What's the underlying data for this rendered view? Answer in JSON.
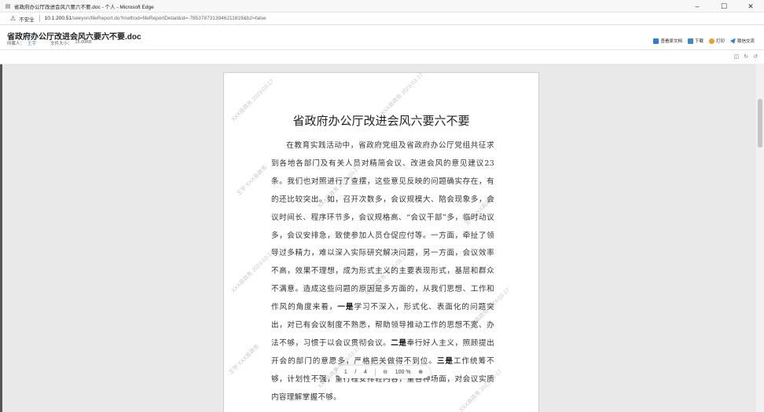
{
  "window": {
    "title": "省政府办公厅改进会风六要六不要.doc - 个人 - Microsoft Edge",
    "minimize": "–",
    "maximize": "☐",
    "close": "✕"
  },
  "address": {
    "warning_icon": "warning-icon",
    "insecure_label": "不安全",
    "host": "10.1.200.51",
    "path": "/seeyon/fileReport.do?method=fileReportDetail&id=-7853787313946211819&b2=false"
  },
  "header": {
    "doc_title": "省政府办公厅改进会风六要六不要.doc",
    "owner_label": "所属人：",
    "owner_name": "王宇",
    "size_label": "文件大小：",
    "size_value": "15.00KB",
    "actions": [
      {
        "label": "查看原文档",
        "icon": "document-icon",
        "color": "#2b7be0"
      },
      {
        "label": "下载",
        "icon": "download-icon",
        "color": "#3a86d8"
      },
      {
        "label": "打印",
        "icon": "print-icon",
        "color": "#f0a020"
      },
      {
        "label": "致信交流",
        "icon": "send-icon",
        "color": "#2b7be0"
      }
    ]
  },
  "toolbar": {
    "icons": [
      "layout-icon",
      "refresh-icon",
      "rotate-icon"
    ],
    "glyphs": [
      "◫",
      "↻",
      "↺"
    ]
  },
  "document": {
    "heading": "省政府办公厅改进会风六要六不要",
    "paragraph_parts": [
      "在教育实践活动中，省政府党组及省政府办公厅党组共征求到各地各部门及有关人员对精简会议、改进会风的意见建议23条。我们也对照进行了查摆，这些意见反映的问题确实存在，有的还比较突出。如，召开次数多，会议规模大、陪会现象多，会议时间长、程序环节多，会议规格高、“会议干部”多，临时动议多，会议安排急，致使参加人员仓促应付等。一方面，牵扯了领导过多精力，难以深入实际研究解决问题，另一方面，会议效率不高，效果不理想，成为形式主义的主要表现形式，基层和群众不满意。造成这些问题的原因是多方面的，从我们思想、工作和作风的角度来看，",
      "一是",
      "学习不深入，形式化、表面化的问题突出，对已有会议制度不熟悉，帮助领导推动工作的思想不宽、办法不够，习惯于以会议贯彻会议。",
      "二是",
      "奉行好人主义，照顾提出开会的部门的意愿多，严格把关做得不到位。",
      "三是",
      "工作统筹不够，计划性不强，重行程安排轻内容，重各种场面，对会议实质内容理解掌握不够。"
    ],
    "watermark_text": "XXX县政务",
    "watermark_name": "王宇",
    "watermark_date": "2023-03-17"
  },
  "pager": {
    "current": "1",
    "separator": "/",
    "total": "4",
    "zoom_out": "⊖",
    "zoom": "100 %",
    "zoom_in": "⊕"
  }
}
